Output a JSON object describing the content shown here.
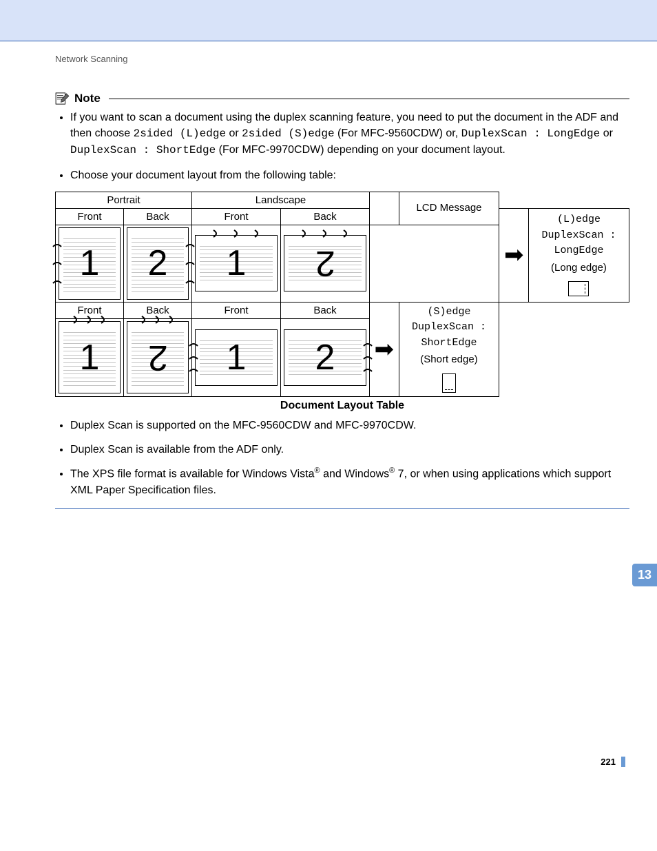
{
  "breadcrumb": "Network Scanning",
  "note": {
    "label": "Note",
    "bullets": {
      "b1a": "If you want to scan a document using the duplex scanning feature, you need to put the document in the ADF and then choose ",
      "b1code1": "2sided (L)edge",
      "b1b": " or ",
      "b1code2": "2sided (S)edge",
      "b1c": " (For MFC-9560CDW) or, ",
      "b1code3": "DuplexScan : LongEdge",
      "b1d": " or ",
      "b1code4": "DuplexScan : ShortEdge",
      "b1e": " (For MFC-9970CDW) depending on your document layout.",
      "b2": "Choose your document layout from the following table:",
      "b3": "Duplex Scan is supported on the MFC-9560CDW and MFC-9970CDW.",
      "b4": "Duplex Scan is available from the ADF only.",
      "b5a": "The XPS file format is available for Windows Vista",
      "b5b": " and Windows",
      "b5c": " 7, or when using applications which support XML Paper Specification files."
    }
  },
  "table": {
    "headers": {
      "portrait": "Portrait",
      "landscape": "Landscape",
      "lcd": "LCD Message"
    },
    "sub": {
      "front": "Front",
      "back": "Back"
    },
    "row1": {
      "lcd_code1": "(L)edge",
      "lcd_code2": "DuplexScan : LongEdge",
      "lcd_plain": "(Long edge)"
    },
    "row2": {
      "lcd_code1": "(S)edge",
      "lcd_code2": "DuplexScan : ShortEdge",
      "lcd_plain": "(Short edge)"
    },
    "nums": {
      "one": "1",
      "two": "2"
    },
    "caption": "Document Layout Table"
  },
  "chapter_tab": "13",
  "page_number": "221",
  "reg": "®"
}
